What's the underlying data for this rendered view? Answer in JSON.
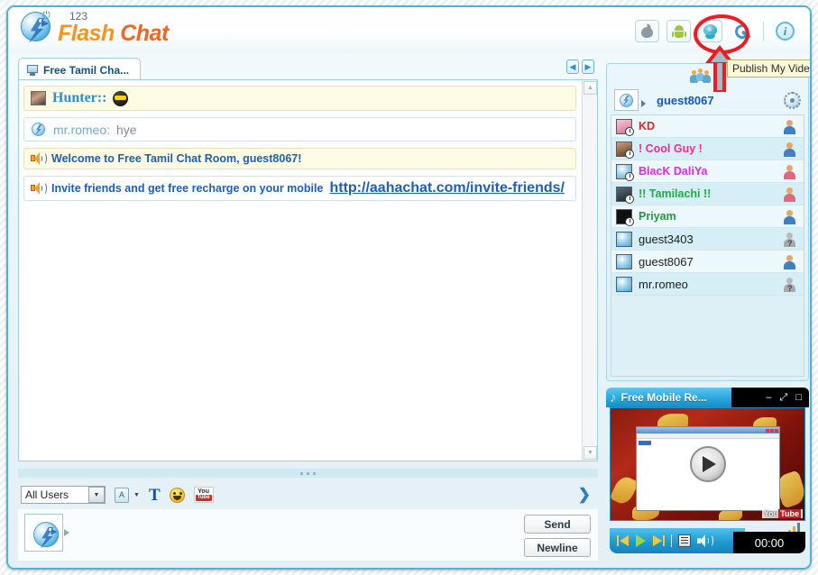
{
  "brand": {
    "prefix": "123",
    "flash": "Flash",
    "chat": "Chat"
  },
  "toolbar": {
    "apple_label": "apple-icon",
    "android_label": "android-icon",
    "webcam_label": "webcam-icon",
    "wrench_label": "settings-icon",
    "info_label": "i"
  },
  "annotation": {
    "tooltip": "Publish My Video",
    "circle_color": "#ee1b23",
    "arrow_color": "#ee1b23"
  },
  "chat": {
    "tab": {
      "label": "Free Tamil Cha...",
      "prev": "◀",
      "next": "▶"
    },
    "scroll": {
      "up": "▲",
      "down": "▼"
    },
    "messages": [
      {
        "type": "user",
        "avatar": "photo",
        "name": "Hunter::",
        "text": "",
        "emoji": "cool-sunglasses",
        "highlight": true
      },
      {
        "type": "user",
        "avatar": "bird",
        "name": "mr.romeo:",
        "text": "hye",
        "highlight": false
      },
      {
        "type": "system",
        "avatar": "speaker",
        "text": "Welcome to Free Tamil Chat Room, guest8067!",
        "highlight": true
      },
      {
        "type": "system",
        "avatar": "speaker",
        "text": "Invite friends and get free recharge on your mobile ",
        "link": "http://aahachat.com/invite-friends/",
        "highlight": false
      }
    ]
  },
  "compose": {
    "recipient": "All Users",
    "recipient_caret": "▼",
    "font_btn": "A",
    "font_caret": "▼",
    "text_btn": "T",
    "smiley_btn": "smiley-icon",
    "youtube_you": "You",
    "youtube_tube": "Tube",
    "expand": "❯",
    "send_label": "Send",
    "newline_label": "Newline"
  },
  "userlist": {
    "count": "8",
    "me": "guest8067",
    "gear": "gear-icon",
    "users": [
      {
        "name": "KD",
        "color": "#e8221f",
        "gender": "male",
        "avatar": "pink",
        "bold": true
      },
      {
        "name": "! Cool Guy !",
        "color": "#ee2e8c",
        "gender": "male",
        "avatar": "face",
        "bold": true
      },
      {
        "name": "BlacK DaliYa",
        "color": "#ee22ee",
        "gender": "female",
        "avatar": "bird",
        "bold": true
      },
      {
        "name": "!! Tamilachi !!",
        "color": "#23a845",
        "gender": "female",
        "avatar": "photo",
        "bold": true
      },
      {
        "name": "Priyam",
        "color": "#1f9b3e",
        "gender": "male",
        "avatar": "dark",
        "bold": true
      },
      {
        "name": "guest3403",
        "color": "#1c1c1c",
        "gender": "unknown",
        "avatar": "bird",
        "bold": false
      },
      {
        "name": "guest8067",
        "color": "#1c1c1c",
        "gender": "male",
        "avatar": "bird",
        "bold": false
      },
      {
        "name": "mr.romeo",
        "color": "#1c1c1c",
        "gender": "unknown",
        "avatar": "bird",
        "bold": false
      }
    ]
  },
  "player": {
    "title": "Free Mobile Re...",
    "note_icon": "♪",
    "minimize": "–",
    "maximize": "⤢",
    "restore": "□",
    "play_overlay": "play-button",
    "youtube_you": "You",
    "youtube_tube": "Tube",
    "time": "00:00"
  }
}
